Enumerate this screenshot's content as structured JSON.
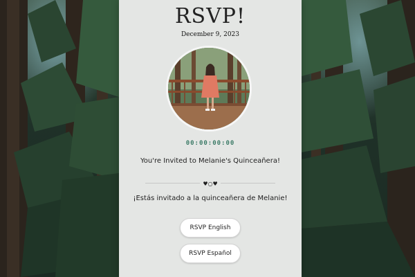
{
  "page": {
    "title": "RSVP!",
    "date": "December 9, 2023",
    "countdown": "00:00:00:00",
    "invite_english": "You're Invited to Melanie's Quinceañera!",
    "divider_ornament": "♥○♥",
    "invite_spanish": "¡Estás invitado a la quinceañera de Melanie!",
    "buttons": {
      "rsvp_english": "RSVP English",
      "rsvp_spanish": "RSVP Español"
    }
  },
  "colors": {
    "card_background": "#e4e6e4",
    "countdown": "#3c7b67",
    "button_background": "#ffffff"
  }
}
